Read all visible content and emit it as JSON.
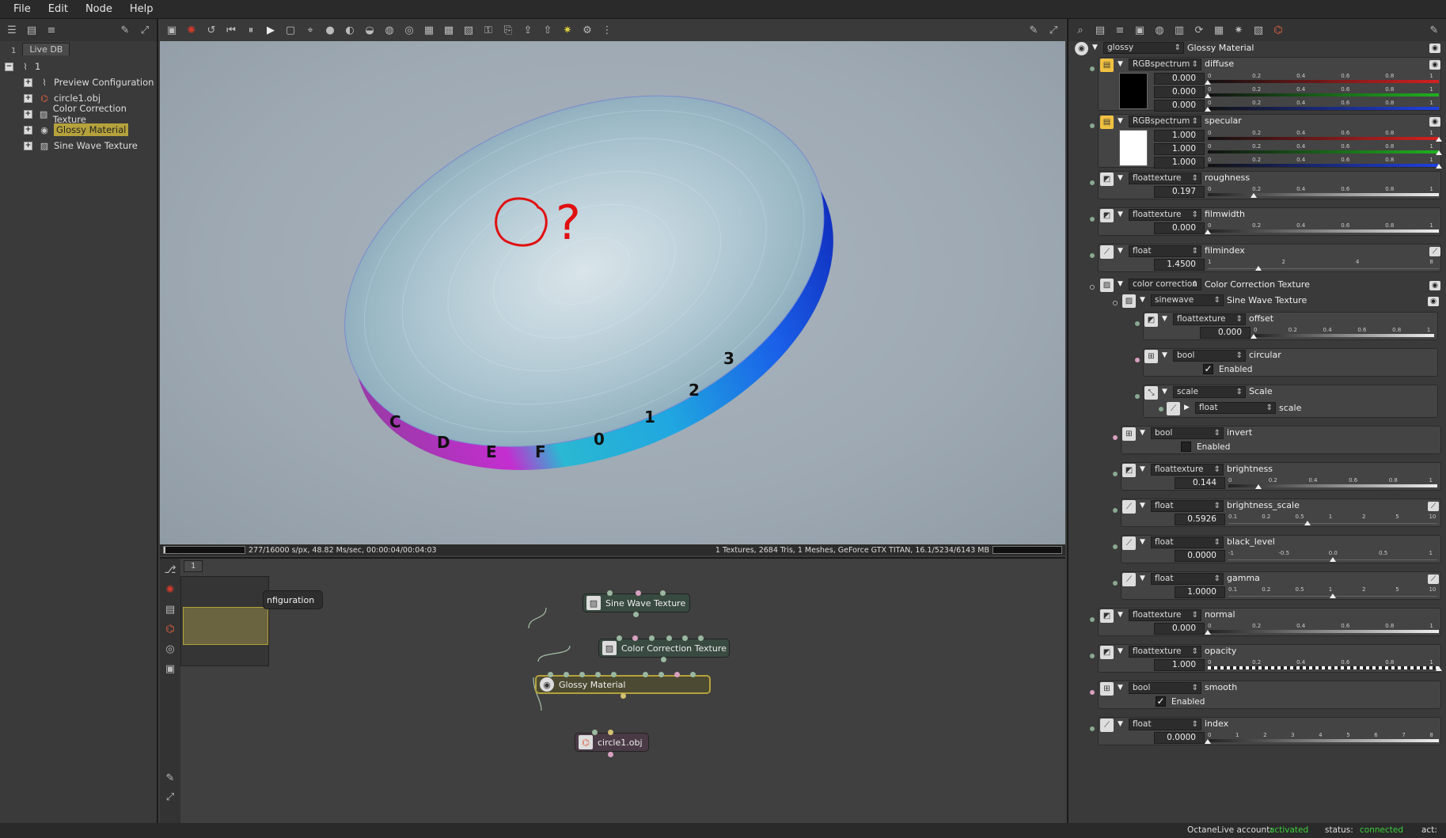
{
  "menu": [
    "File",
    "Edit",
    "Node",
    "Help"
  ],
  "outliner": {
    "tab_num": "1",
    "tab_label": "Live DB",
    "root_label": "1",
    "items": [
      {
        "label": "Preview Configuration",
        "icon": "graph-icon"
      },
      {
        "label": "circle1.obj",
        "icon": "mesh-icon"
      },
      {
        "label": "Color Correction Texture",
        "icon": "texture-icon"
      },
      {
        "label": "Glossy Material",
        "icon": "material-icon",
        "selected": true
      },
      {
        "label": "Sine Wave Texture",
        "icon": "texture-icon"
      }
    ]
  },
  "render": {
    "annotation_text": "?",
    "status_left": "277/16000 s/px, 48.82 Ms/sec, 00:00:04/00:04:03",
    "status_right": "1 Textures, 2684 Tris, 1 Meshes, GeForce GTX TITAN, 16.1/5234/6143 MB",
    "render_progress": 0.017,
    "edge_letters": [
      "C",
      "D",
      "E",
      "F",
      "0",
      "1",
      "2",
      "3"
    ]
  },
  "node_graph": {
    "tab": "1",
    "partial_label": "nfiguration",
    "nodes": {
      "sine": "Sine Wave Texture",
      "cc": "Color Correction Texture",
      "glossy": "Glossy Material",
      "mesh": "circle1.obj"
    }
  },
  "inspector": {
    "header_type": "glossy",
    "header_name": "Glossy Material",
    "params": {
      "diffuse": {
        "type": "RGBspectrum",
        "name": "diffuse",
        "values": [
          "0.000",
          "0.000",
          "0.000"
        ],
        "swatch": "#000000"
      },
      "specular": {
        "type": "RGBspectrum",
        "name": "specular",
        "values": [
          "1.000",
          "1.000",
          "1.000"
        ],
        "swatch": "#ffffff"
      },
      "roughness": {
        "type": "floattexture",
        "name": "roughness",
        "value": "0.197"
      },
      "filmwidth": {
        "type": "floattexture",
        "name": "filmwidth",
        "value": "0.000"
      },
      "filmindex": {
        "type": "float",
        "name": "filmindex",
        "value": "1.4500"
      },
      "cc": {
        "type": "color correction",
        "name": "Color Correction Texture"
      },
      "sine": {
        "type": "sinewave",
        "name": "Sine Wave Texture"
      },
      "offset": {
        "type": "floattexture",
        "name": "offset",
        "value": "0.000"
      },
      "circular": {
        "type": "bool",
        "name": "circular",
        "check_label": "Enabled",
        "checked": true
      },
      "scale": {
        "type": "scale",
        "name": "Scale"
      },
      "scale_float": {
        "type": "float",
        "name": "scale"
      },
      "invert": {
        "type": "bool",
        "name": "invert",
        "check_label": "Enabled",
        "checked": false
      },
      "brightness": {
        "type": "floattexture",
        "name": "brightness",
        "value": "0.144"
      },
      "brightness_scale": {
        "type": "float",
        "name": "brightness_scale",
        "value": "0.5926"
      },
      "black_level": {
        "type": "float",
        "name": "black_level",
        "value": "0.0000"
      },
      "gamma": {
        "type": "float",
        "name": "gamma",
        "value": "1.0000"
      },
      "normal": {
        "type": "floattexture",
        "name": "normal",
        "value": "0.000"
      },
      "opacity": {
        "type": "floattexture",
        "name": "opacity",
        "value": "1.000"
      },
      "smooth": {
        "type": "bool",
        "name": "smooth",
        "check_label": "Enabled",
        "checked": true
      },
      "index": {
        "type": "float",
        "name": "index",
        "value": "0.0000"
      }
    },
    "ticks": {
      "unit": [
        "0",
        "0.2",
        "0.4",
        "0.6",
        "0.8",
        "1"
      ],
      "filmindex": [
        "1",
        "2",
        "4",
        "8"
      ],
      "log": [
        "0.1",
        "0.2",
        "0.5",
        "1",
        "2",
        "5",
        "10"
      ],
      "black": [
        "-1",
        "-0.5",
        "0.0",
        "0.5",
        "1"
      ],
      "index": [
        "0",
        "1",
        "2",
        "3",
        "4",
        "5",
        "6",
        "7",
        "8"
      ]
    }
  },
  "footer": {
    "account_label": "OctaneLive account:",
    "account_value": "activated",
    "status_label": "status:",
    "status_value": "connected",
    "act_label": "act:"
  },
  "colors": {
    "accent": "#b5a23c",
    "ok_green": "#3ad03a",
    "red": "#d42020",
    "green": "#20b020",
    "blue": "#2040e0"
  }
}
